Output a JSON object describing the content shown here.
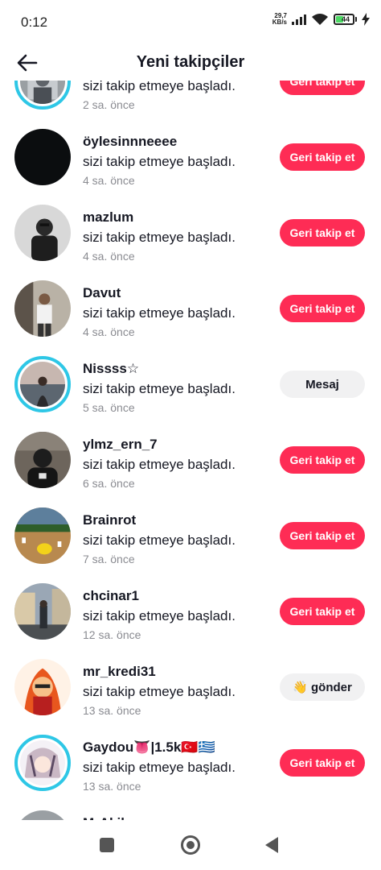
{
  "status": {
    "time": "0:12",
    "net_speed_value": "29,7",
    "net_speed_unit": "KB/s",
    "battery": "44"
  },
  "header": {
    "title": "Yeni takipçiler"
  },
  "followers": [
    {
      "username": "",
      "action": "sizi takip etmeye başladı.",
      "time": "2 sa. önce",
      "button": "Geri takip et",
      "button_type": "follow",
      "ring": true,
      "avatar": "photo-gray"
    },
    {
      "username": "öylesinnneeee",
      "action": "sizi takip etmeye başladı.",
      "time": "4 sa. önce",
      "button": "Geri takip et",
      "button_type": "follow",
      "ring": false,
      "avatar": "black"
    },
    {
      "username": "mazlum",
      "action": "sizi takip etmeye başladı.",
      "time": "4 sa. önce",
      "button": "Geri takip et",
      "button_type": "follow",
      "ring": false,
      "avatar": "bw-person"
    },
    {
      "username": "Davut",
      "action": "sizi takip etmeye başladı.",
      "time": "4 sa. önce",
      "button": "Geri takip et",
      "button_type": "follow",
      "ring": false,
      "avatar": "mirror-selfie"
    },
    {
      "username": "Nissss☆",
      "action": "sizi takip etmeye başladı.",
      "time": "5 sa. önce",
      "button": "Mesaj",
      "button_type": "message",
      "ring": true,
      "avatar": "beach-sunset"
    },
    {
      "username": "ylmz_ern_7",
      "action": "sizi takip etmeye başladı.",
      "time": "6 sa. önce",
      "button": "Geri takip et",
      "button_type": "follow",
      "ring": false,
      "avatar": "dark-cap"
    },
    {
      "username": "Brainrot",
      "action": "sizi takip etmeye başladı.",
      "time": "7 sa. önce",
      "button": "Geri takip et",
      "button_type": "follow",
      "ring": false,
      "avatar": "arena"
    },
    {
      "username": "chcinar1",
      "action": "sizi takip etmeye başladı.",
      "time": "12 sa. önce",
      "button": "Geri takip et",
      "button_type": "follow",
      "ring": false,
      "avatar": "street"
    },
    {
      "username": "mr_kredi31",
      "action": "sizi takip etmeye başladı.",
      "time": "13 sa. önce",
      "button": "👋 gönder",
      "button_type": "wave",
      "ring": false,
      "avatar": "cartoon-fire"
    },
    {
      "username": "Gaydou👅|1.5k🇹🇷🇬🇷",
      "action": "sizi takip etmeye başladı.",
      "time": "13 sa. önce",
      "button": "Geri takip et",
      "button_type": "follow",
      "ring": true,
      "avatar": "anime"
    },
    {
      "username": "MrAkil",
      "action": "",
      "time": "",
      "button": "",
      "button_type": "none",
      "ring": false,
      "avatar": "photo-gray"
    }
  ],
  "colors": {
    "accent": "#fe2c55",
    "ring": "#2ec7e6",
    "secondary_text": "#8a8b91"
  },
  "nav": {
    "icons": [
      "recent-apps-icon",
      "home-icon",
      "back-icon"
    ]
  }
}
